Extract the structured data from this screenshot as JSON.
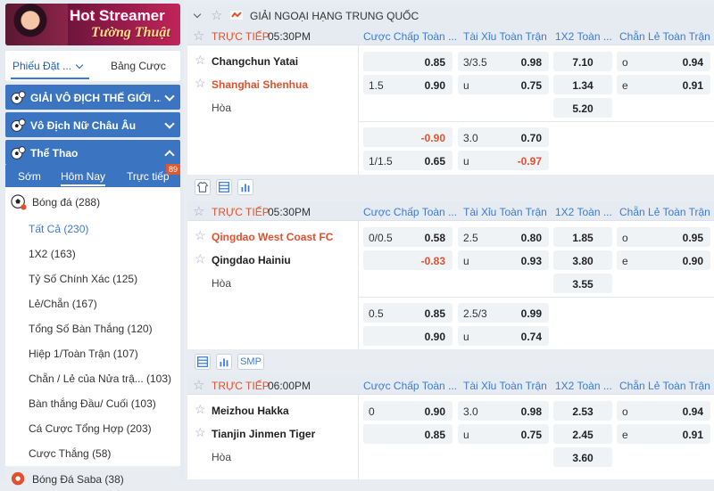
{
  "banner": {
    "line1": "Hot Streamer",
    "line2": "Tường Thuật"
  },
  "bet_tabs": {
    "active": "Phiếu Đặt ...",
    "other": "Bảng Cược"
  },
  "sections": [
    {
      "label": "GIẢI VÔ ĐỊCH THẾ GIỚI ..."
    },
    {
      "label": "Vô Địch Nữ Châu Âu"
    },
    {
      "label": "Thể Thao"
    }
  ],
  "subtabs": {
    "early": "Sớm",
    "today": "Hôm Nay",
    "live": "Trực tiếp",
    "live_count": "89"
  },
  "sports": {
    "main": {
      "label": "Bóng đá",
      "count": "(288)"
    },
    "items": [
      {
        "label": "Tất Cả",
        "count": "(230)"
      },
      {
        "label": "1X2",
        "count": "(163)"
      },
      {
        "label": "Tỷ Số Chính Xác",
        "count": "(125)"
      },
      {
        "label": "Lẻ/Chẵn",
        "count": "(167)"
      },
      {
        "label": "Tổng Số Bàn Thắng",
        "count": "(120)"
      },
      {
        "label": "Hiệp 1/Toàn Trận",
        "count": "(107)"
      },
      {
        "label": "Chẵn / Lẻ của Nửa trậ...",
        "count": "(103)"
      },
      {
        "label": "Bàn thắng Đầu/ Cuối",
        "count": "(103)"
      },
      {
        "label": "Cá Cược Tổng Hợp",
        "count": "(203)"
      },
      {
        "label": "Cược Thắng",
        "count": "(58)"
      }
    ],
    "saba": {
      "label": "Bóng Đá Saba",
      "count": "(38)"
    }
  },
  "league": {
    "name": "GIẢI NGOẠI HẠNG TRUNG QUỐC"
  },
  "col_headers": {
    "handicap": "Cược Chấp Toàn ...",
    "overunder": "Tài Xỉu Toàn Trận",
    "onextwo": "1X2 Toàn ...",
    "oddeven": "Chẵn Lẻ Toàn Trận"
  },
  "draw_label": "Hòa",
  "smp_label": "SMP",
  "matches": [
    {
      "status": "TRỰC TIẾP",
      "time": "05:30PM",
      "home": "Changchun Yatai",
      "away": "Shanghai Shenhua",
      "hdp1": [
        {
          "a": "",
          "b": "0.85"
        },
        {
          "a": "1.5",
          "b": "0.90"
        }
      ],
      "ou1": [
        {
          "a": "3/3.5",
          "b": "0.98"
        },
        {
          "a": "u",
          "b": "0.75"
        }
      ],
      "x12": [
        "7.10",
        "1.34",
        "5.20"
      ],
      "oe": [
        {
          "a": "o",
          "b": "0.94"
        },
        {
          "a": "e",
          "b": "0.91"
        }
      ],
      "hdp2": [
        {
          "a": "",
          "b": "-0.90"
        },
        {
          "a": "1/1.5",
          "b": "0.65"
        }
      ],
      "ou2": [
        {
          "a": "3.0",
          "b": "0.70"
        },
        {
          "a": "u",
          "b": "-0.97"
        }
      ]
    },
    {
      "status": "TRỰC TIẾP",
      "time": "05:30PM",
      "home": "Qingdao West Coast FC",
      "away": "Qingdao Hainiu",
      "hdp1": [
        {
          "a": "0/0.5",
          "b": "0.58"
        },
        {
          "a": "",
          "b": "-0.83"
        }
      ],
      "ou1": [
        {
          "a": "2.5",
          "b": "0.80"
        },
        {
          "a": "u",
          "b": "0.93"
        }
      ],
      "x12": [
        "1.85",
        "3.80",
        "3.55"
      ],
      "oe": [
        {
          "a": "o",
          "b": "0.95"
        },
        {
          "a": "e",
          "b": "0.90"
        }
      ],
      "hdp2": [
        {
          "a": "0.5",
          "b": "0.85"
        },
        {
          "a": "",
          "b": "0.90"
        }
      ],
      "ou2": [
        {
          "a": "2.5/3",
          "b": "0.99"
        },
        {
          "a": "u",
          "b": "0.74"
        }
      ]
    },
    {
      "status": "TRỰC TIẾP",
      "time": "06:00PM",
      "home": "Meizhou Hakka",
      "away": "Tianjin Jinmen Tiger",
      "hdp1": [
        {
          "a": "0",
          "b": "0.90"
        },
        {
          "a": "",
          "b": "0.85"
        }
      ],
      "ou1": [
        {
          "a": "3.0",
          "b": "0.98"
        },
        {
          "a": "u",
          "b": "0.75"
        }
      ],
      "x12": [
        "2.53",
        "2.45",
        "3.60"
      ],
      "oe": [
        {
          "a": "o",
          "b": "0.94"
        },
        {
          "a": "e",
          "b": "0.91"
        }
      ]
    }
  ],
  "colors": {
    "accent": "#3b74c1",
    "live": "#e0512d",
    "negative": "#e0512d"
  },
  "icons": [
    "soccer-ball-icon",
    "star-icon",
    "collapse-chevron-icon",
    "flag-china-icon",
    "jersey-icon",
    "stats-table-icon",
    "bar-chart-icon"
  ]
}
